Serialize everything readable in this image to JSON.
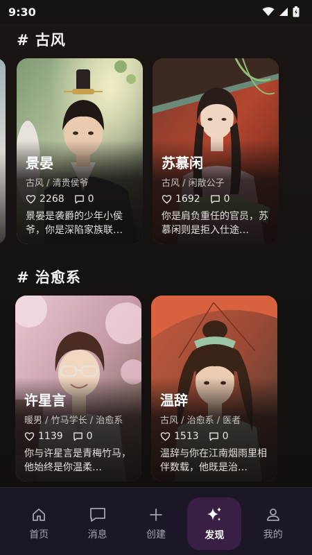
{
  "status": {
    "time": "9:30"
  },
  "sections": [
    {
      "title": "# 古风",
      "cards": [
        {
          "name": "景晏",
          "tags": "古风 / 清贵侯爷",
          "likes": "2268",
          "comments": "0",
          "desc": "景晏是袭爵的少年小侯爷，你是深陷家族联…"
        },
        {
          "name": "苏慕闲",
          "tags": "古风 / 闲散公子",
          "likes": "1692",
          "comments": "0",
          "desc": "你是肩负重任的官员，苏慕闲则是拒入仕途…"
        }
      ]
    },
    {
      "title": "# 治愈系",
      "cards": [
        {
          "name": "许星言",
          "tags": "暖男 / 竹马学长 / 治愈系",
          "likes": "1139",
          "comments": "0",
          "desc": "你与许星言是青梅竹马，他始终是你温柔…"
        },
        {
          "name": "温辞",
          "tags": "古风 / 治愈系 / 医者",
          "likes": "1513",
          "comments": "0",
          "desc": "温辞与你在江南烟雨里相伴数载，他既是治…"
        }
      ]
    }
  ],
  "tabs": [
    {
      "label": "首页",
      "icon": "home-icon"
    },
    {
      "label": "消息",
      "icon": "message-icon"
    },
    {
      "label": "创建",
      "icon": "plus-icon"
    },
    {
      "label": "发现",
      "icon": "sparkle-icon",
      "active": true
    },
    {
      "label": "我的",
      "icon": "person-icon"
    }
  ]
}
